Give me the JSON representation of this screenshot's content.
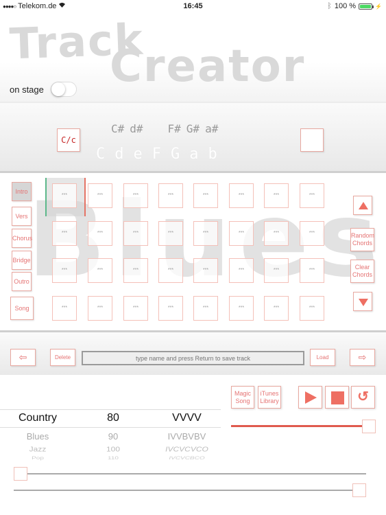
{
  "status_bar": {
    "signal": "●●●●○",
    "carrier": "Telekom.de",
    "wifi_icon": "wifi-icon",
    "time": "16:45",
    "bluetooth_icon": "bluetooth-icon",
    "battery_text": "100 %",
    "battery_level_percent": 100,
    "charging_icon": "⚡"
  },
  "header": {
    "logo_line1": "Track",
    "logo_line2": "Creator",
    "on_stage_label": "on stage",
    "on_stage_value": false
  },
  "key_bar": {
    "case_toggle_label": "C/c",
    "sharps": [
      "C#",
      "d#",
      "F#",
      "G#",
      "a#"
    ],
    "naturals": [
      "C",
      "d",
      "e",
      "F",
      "G",
      "a",
      "b"
    ]
  },
  "grid": {
    "watermark": "Blues",
    "sections": [
      {
        "label": "Intro",
        "active": true
      },
      {
        "label": "Vers",
        "active": false
      },
      {
        "label": "Chorus",
        "active": false
      },
      {
        "label": "Bridge",
        "active": false
      },
      {
        "label": "Outro",
        "active": false
      }
    ],
    "song_label": "Song",
    "cell_placeholder": "***",
    "rows": 4,
    "cols": 8,
    "random_label_1": "Random",
    "random_label_2": "Chords",
    "clear_label_1": "Clear",
    "clear_label_2": "Chords"
  },
  "file_bar": {
    "prev_arrow": "⇦",
    "delete_label": "Delete",
    "name_placeholder": "type name and press Return to save track",
    "name_value": "",
    "load_label": "Load",
    "next_arrow": "⇨"
  },
  "controls": {
    "magic_1": "Magic",
    "magic_2": "Song",
    "itunes_1": "iTunes",
    "itunes_2": "Library",
    "repeat_glyph": "↺",
    "volume_fraction": 0.97
  },
  "picker": {
    "genres": [
      "Country",
      "Blues",
      "Jazz",
      "Pop"
    ],
    "tempos": [
      "80",
      "90",
      "100",
      "110"
    ],
    "patterns": [
      "VVVV",
      "IVVBVBV",
      "IVCVCVCO",
      "IVCVCBCO"
    ]
  },
  "sliders": {
    "slider1_fraction": 0.0,
    "slider2_fraction": 1.0
  }
}
